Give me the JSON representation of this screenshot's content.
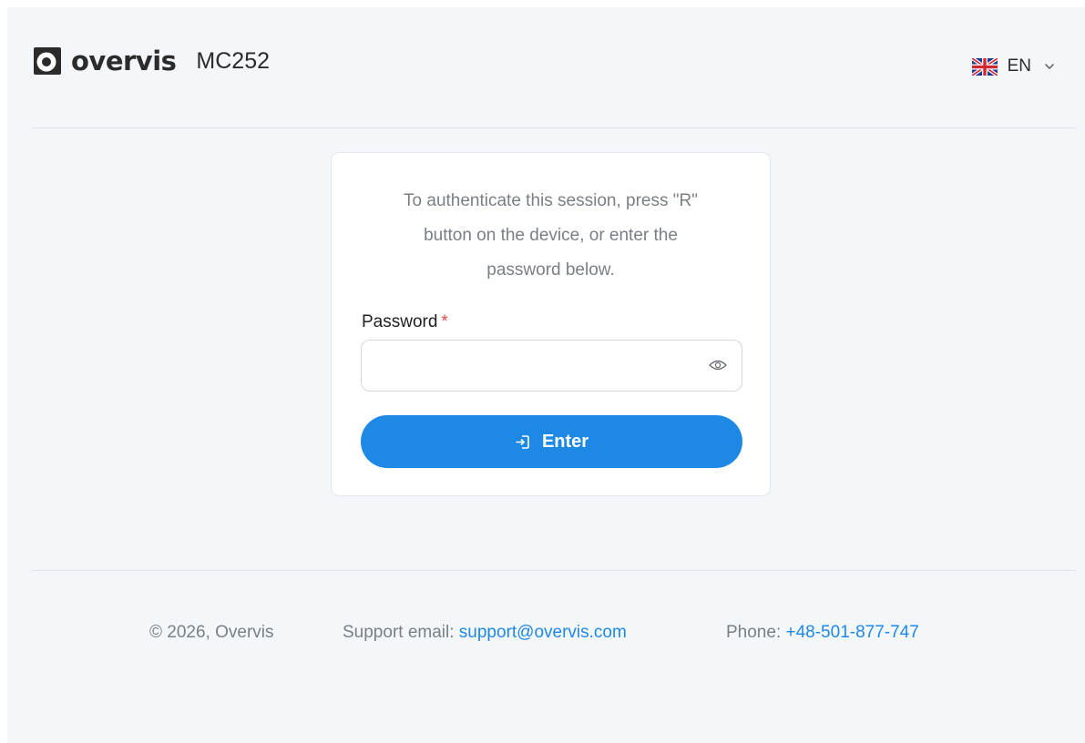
{
  "header": {
    "brand": "overvis",
    "model": "MC252",
    "language": {
      "code": "EN",
      "flag_icon": "uk-flag-icon"
    }
  },
  "login": {
    "intro_lines": [
      "To authenticate this session, press \"R\"",
      "button on the device, or enter the",
      "password below."
    ],
    "password_label": "Password",
    "required_marker": "*",
    "password_value": "",
    "password_placeholder": "",
    "enter_label": "Enter"
  },
  "footer": {
    "copyright": "© 2026, Overvis",
    "support_label": "Support email: ",
    "support_email": "support@overvis.com",
    "phone_label": "Phone: ",
    "phone_number": "+48-501-877-747"
  },
  "colors": {
    "accent": "#1e88e5",
    "background": "#f4f7f9",
    "required": "#e5484d",
    "muted_text": "#7a7f85"
  }
}
